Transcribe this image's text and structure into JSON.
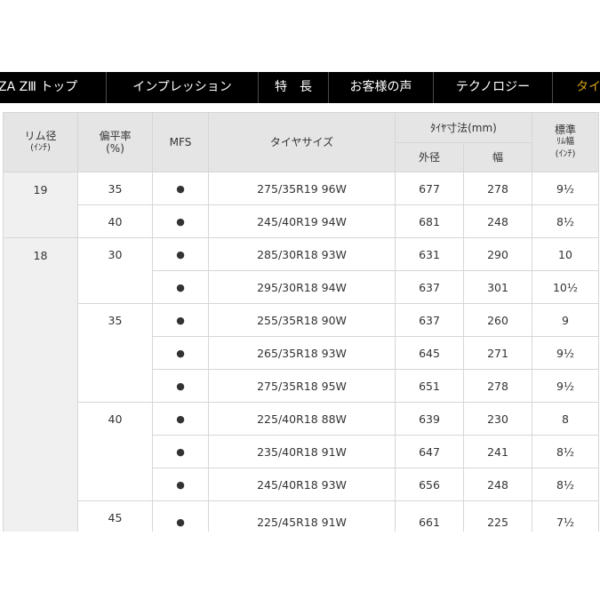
{
  "nav": {
    "items": [
      {
        "label": "ZA ZⅢ トップ"
      },
      {
        "label": "インプレッション"
      },
      {
        "label": "特　長"
      },
      {
        "label": "お客様の声"
      },
      {
        "label": "テクノロジー"
      },
      {
        "label": "タイ"
      }
    ]
  },
  "table": {
    "headers": {
      "rim_main": "リム径",
      "rim_sub": "(ｲﾝﾁ)",
      "aspect_main": "偏平率",
      "aspect_sub": "(%)",
      "mfs": "MFS",
      "size": "タイヤサイズ",
      "dims_group": "ﾀｲﾔ寸法(mm)",
      "outer": "外径",
      "width": "幅",
      "std_rim_1": "標準",
      "std_rim_2": "ﾘﾑ幅",
      "std_rim_3": "(ｲﾝﾁ)"
    },
    "mfs_mark": "●",
    "rims": [
      "19",
      "18"
    ],
    "aspects": [
      "35",
      "40",
      "30",
      "35",
      "40",
      "45"
    ],
    "rows": [
      {
        "size": "275/35R19 96W",
        "outer": "677",
        "width": "278",
        "rim_width": "9½"
      },
      {
        "size": "245/40R19 94W",
        "outer": "681",
        "width": "248",
        "rim_width": "8½"
      },
      {
        "size": "285/30R18 93W",
        "outer": "631",
        "width": "290",
        "rim_width": "10"
      },
      {
        "size": "295/30R18 94W",
        "outer": "637",
        "width": "301",
        "rim_width": "10½"
      },
      {
        "size": "255/35R18 90W",
        "outer": "637",
        "width": "260",
        "rim_width": "9"
      },
      {
        "size": "265/35R18 93W",
        "outer": "645",
        "width": "271",
        "rim_width": "9½"
      },
      {
        "size": "275/35R18 95W",
        "outer": "651",
        "width": "278",
        "rim_width": "9½"
      },
      {
        "size": "225/40R18 88W",
        "outer": "639",
        "width": "230",
        "rim_width": "8"
      },
      {
        "size": "235/40R18 91W",
        "outer": "647",
        "width": "241",
        "rim_width": "8½"
      },
      {
        "size": "245/40R18 93W",
        "outer": "656",
        "width": "248",
        "rim_width": "8½"
      },
      {
        "size": "225/45R18 91W",
        "outer": "661",
        "width": "225",
        "rim_width": "7½"
      }
    ]
  }
}
